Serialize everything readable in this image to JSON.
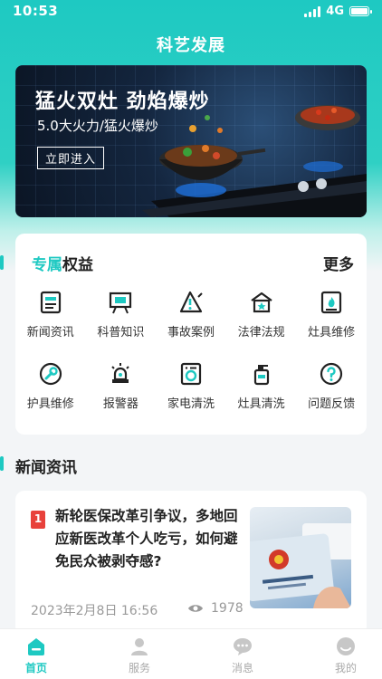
{
  "status_bar": {
    "time": "10:53",
    "network": "4G"
  },
  "page_title": "科艺发展",
  "banner": {
    "title": "猛火双灶 劲焰爆炒",
    "subtitle": "5.0大火力/猛火爆炒",
    "button_label": "立即进入"
  },
  "benefits": {
    "title_highlight": "专属",
    "title_rest": "权益",
    "more_label": "更多",
    "items": [
      {
        "label": "新闻资讯",
        "icon": "news-icon"
      },
      {
        "label": "科普知识",
        "icon": "presentation-board-icon"
      },
      {
        "label": "事故案例",
        "icon": "warning-icon"
      },
      {
        "label": "法律法规",
        "icon": "law-house-icon"
      },
      {
        "label": "灶具维修",
        "icon": "stove-flame-icon"
      },
      {
        "label": "护具维修",
        "icon": "wrench-icon"
      },
      {
        "label": "报警器",
        "icon": "alarm-siren-icon"
      },
      {
        "label": "家电清洗",
        "icon": "washing-machine-icon"
      },
      {
        "label": "灶具清洗",
        "icon": "spray-bottle-icon"
      },
      {
        "label": "问题反馈",
        "icon": "question-icon"
      }
    ]
  },
  "news_section": {
    "title": "新闻资讯",
    "items": [
      {
        "rank": "1",
        "title": "新轮医保改革引争议，多地回应新医改革个人吃亏，如何避免民众被剥夺感?",
        "date": "2023年2月8日  16:56",
        "views": "1978",
        "thumbnail_icon": "social-security-card-image"
      }
    ]
  },
  "tabbar": {
    "items": [
      {
        "label": "首页",
        "icon": "home-icon",
        "active": true
      },
      {
        "label": "服务",
        "icon": "user-icon",
        "active": false
      },
      {
        "label": "消息",
        "icon": "message-icon",
        "active": false
      },
      {
        "label": "我的",
        "icon": "profile-icon",
        "active": false
      }
    ]
  },
  "colors": {
    "accent": "#1ec9c2",
    "badge": "#e8413b"
  }
}
